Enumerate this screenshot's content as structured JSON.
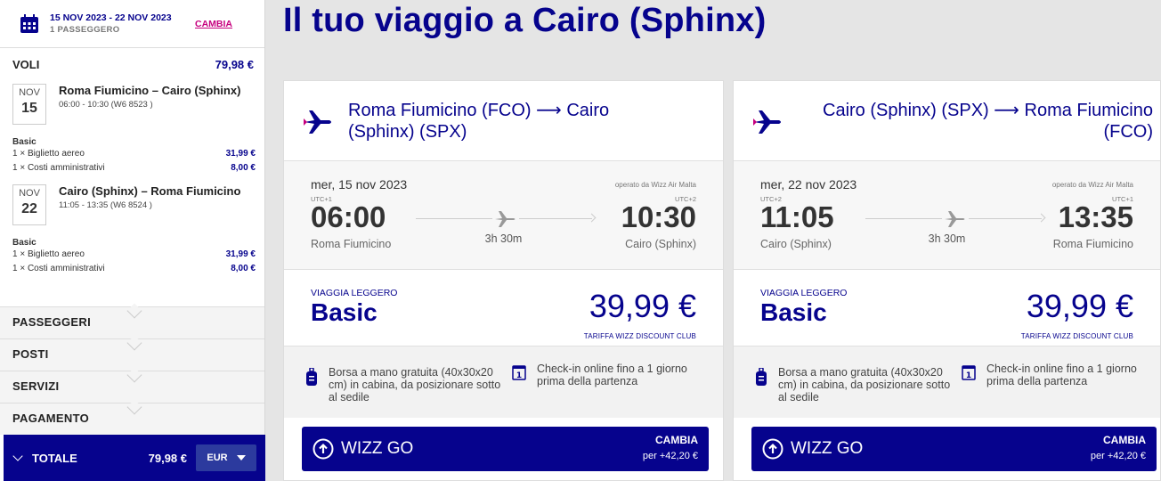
{
  "sidebar": {
    "dates": "15 NOV 2023 - 22 NOV 2023",
    "passengers": "1 PASSEGGERO",
    "change": "CAMBIA",
    "voli_label": "VOLI",
    "voli_total": "79,98 €",
    "flights": [
      {
        "month": "NOV",
        "day": "15",
        "route": "Roma Fiumicino – Cairo (Sphinx)",
        "times": "06:00 - 10:30 (W6 8523 )",
        "fare": "Basic",
        "lines": [
          {
            "label": "1 × Biglietto aereo",
            "price": "31,99 €"
          },
          {
            "label": "1 × Costi amministrativi",
            "price": "8,00 €"
          }
        ]
      },
      {
        "month": "NOV",
        "day": "22",
        "route": "Cairo (Sphinx) – Roma Fiumicino",
        "times": "11:05 - 13:35 (W6 8524 )",
        "fare": "Basic",
        "lines": [
          {
            "label": "1 × Biglietto aereo",
            "price": "31,99 €"
          },
          {
            "label": "1 × Costi amministrativi",
            "price": "8,00 €"
          }
        ]
      }
    ],
    "sections": [
      "PASSEGGERI",
      "POSTI",
      "SERVIZI",
      "PAGAMENTO"
    ],
    "total_label": "TOTALE",
    "total_amount": "79,98 €",
    "currency": "EUR"
  },
  "main": {
    "title": "Il tuo viaggio a Cairo (Sphinx)",
    "cards": [
      {
        "route": "Roma Fiumicino (FCO) ⟶ Cairo (Sphinx) (SPX)",
        "date": "mer, 15 nov 2023",
        "operated": "operato da Wizz Air Malta",
        "dep_utc": "UTC+1",
        "arr_utc": "UTC+2",
        "dep_time": "06:00",
        "arr_time": "10:30",
        "from": "Roma Fiumicino",
        "to": "Cairo (Sphinx)",
        "duration": "3h 30m",
        "fare_tag": "VIAGGIA LEGGERO",
        "fare_name": "Basic",
        "price": "39,99 €",
        "club": "TARIFFA WIZZ DISCOUNT CLUB",
        "bag": "Borsa a mano gratuita (40x30x20 cm) in cabina, da posizionare sotto al sedile",
        "checkin": "Check-in online fino a 1 giorno prima della partenza",
        "wizz_label": "WIZZ GO",
        "wizz_cambia": "CAMBIA",
        "wizz_extra": "per +42,20 €"
      },
      {
        "route": "Cairo (Sphinx) (SPX) ⟶ Roma Fiumicino (FCO)",
        "date": "mer, 22 nov 2023",
        "operated": "operato da Wizz Air Malta",
        "dep_utc": "UTC+2",
        "arr_utc": "UTC+1",
        "dep_time": "11:05",
        "arr_time": "13:35",
        "from": "Cairo (Sphinx)",
        "to": "Roma Fiumicino",
        "duration": "3h 30m",
        "fare_tag": "VIAGGIA LEGGERO",
        "fare_name": "Basic",
        "price": "39,99 €",
        "club": "TARIFFA WIZZ DISCOUNT CLUB",
        "bag": "Borsa a mano gratuita (40x30x20 cm) in cabina, da posizionare sotto al sedile",
        "checkin": "Check-in online fino a 1 giorno prima della partenza",
        "wizz_label": "WIZZ GO",
        "wizz_cambia": "CAMBIA",
        "wizz_extra": "per +42,20 €"
      }
    ]
  },
  "colors": {
    "brand": "#06038d",
    "accent": "#c6007e"
  }
}
